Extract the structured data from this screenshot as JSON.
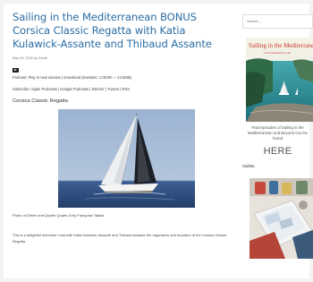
{
  "post": {
    "title": "Sailing in the Mediterranean BONUS Corsica Classic Regatta with Katia Kulawick-Assante and Thibaud Assante",
    "date_author": "May 30, 2020 by Zarah",
    "podcast_line": "Podcast: Play in new window | Download (Duration: 1:05:09 — 44.8MB)",
    "subscribe_line": "Subscribe: Apple Podcasts | Google Podcasts | Stitcher | TuneIn | RSS",
    "section_heading": "Corsica Classic Regatta",
    "photo_caption": "Photo of Eileen and Quatre Quarts III by Françoise Tallani",
    "body_text": "This is a delightful interview I had with Katia Kulawick-Assante  and Thibaud Assante the organizers and founders of the Corsica Classic Regatta"
  },
  "sidebar": {
    "search_placeholder": "Search ...",
    "banner_title": "Sailing in the Mediterranean",
    "banner_url": "www.medisailor.com",
    "past_episodes_text": "Past Episodes of Sailing in the Mediterranean and Beyond Can be found",
    "here_link": "HERE",
    "heading": "Sailrite"
  },
  "colors": {
    "title_link": "#2b6ea5",
    "banner_text": "#c8372d",
    "page_background": "#f3f3f3"
  },
  "icons": {
    "play": "play-icon"
  }
}
